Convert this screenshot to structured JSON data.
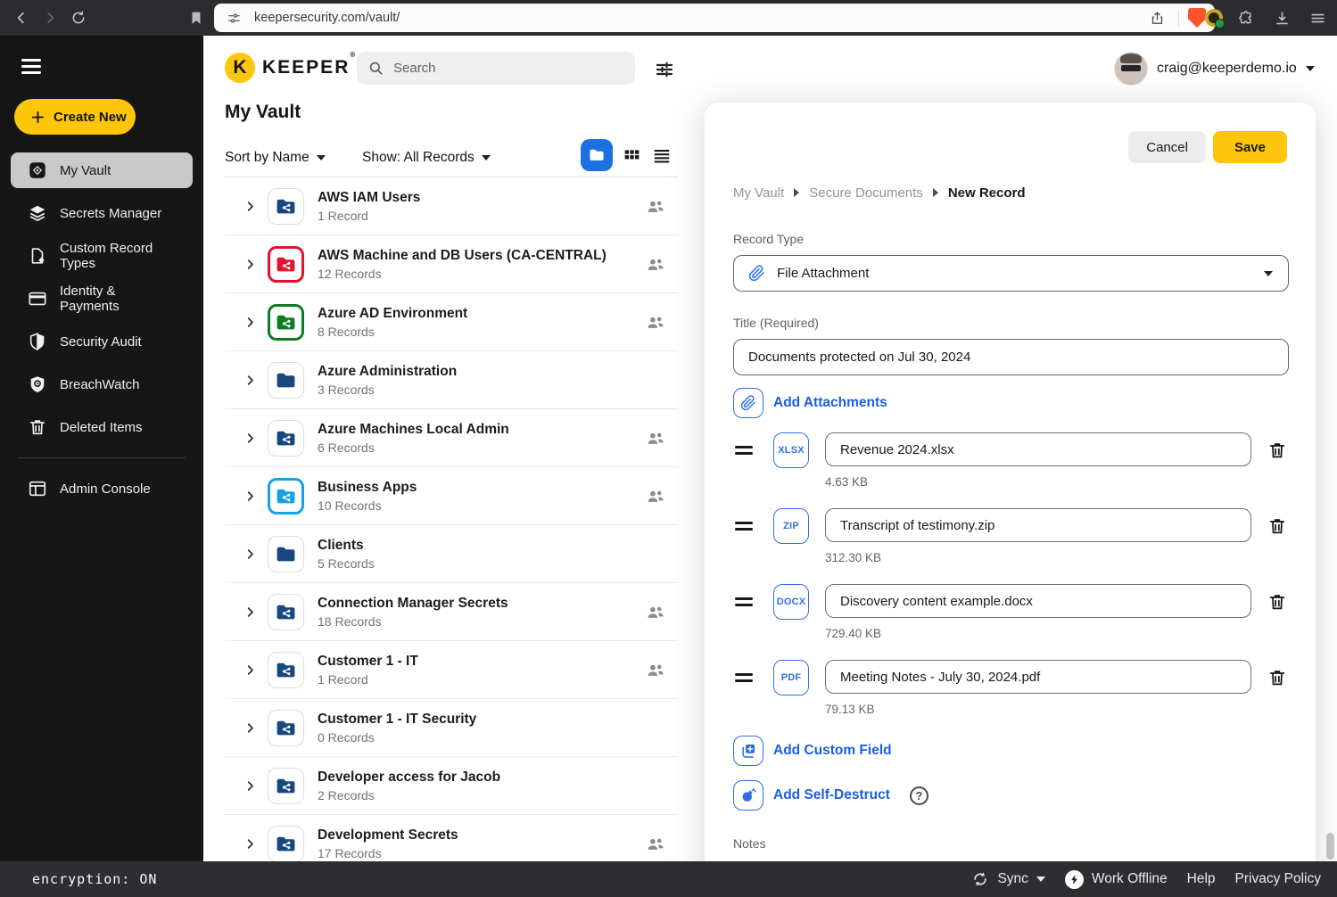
{
  "browser": {
    "url": "keepersecurity.com/vault/"
  },
  "header": {
    "brand": "KEEPER",
    "brand_reg": "®",
    "brand_initial": "K",
    "search_placeholder": "Search",
    "account_email": "craig@keeperdemo.io"
  },
  "sidebar": {
    "create_new": "Create New",
    "items": [
      {
        "label": "My Vault",
        "active": true
      },
      {
        "label": "Secrets Manager"
      },
      {
        "label": "Custom Record Types"
      },
      {
        "label": "Identity & Payments"
      },
      {
        "label": "Security Audit"
      },
      {
        "label": "BreachWatch"
      },
      {
        "label": "Deleted Items"
      },
      {
        "label": "Admin Console"
      }
    ]
  },
  "vault": {
    "title": "My Vault",
    "sort_label": "Sort by Name",
    "show_label": "Show: All Records",
    "folders": [
      {
        "name": "AWS IAM Users",
        "count": "1 Record",
        "style": "default",
        "people": true
      },
      {
        "name": "AWS Machine and DB Users (CA-CENTRAL)",
        "count": "12 Records",
        "style": "red",
        "people": true
      },
      {
        "name": "Azure AD Environment",
        "count": "8 Records",
        "style": "green",
        "people": true
      },
      {
        "name": "Azure Administration",
        "count": "3 Records",
        "style": "plain",
        "people": false
      },
      {
        "name": "Azure Machines Local Admin",
        "count": "6 Records",
        "style": "default",
        "people": true
      },
      {
        "name": "Business Apps",
        "count": "10 Records",
        "style": "cyan",
        "people": true
      },
      {
        "name": "Clients",
        "count": "5 Records",
        "style": "plain",
        "people": false
      },
      {
        "name": "Connection Manager Secrets",
        "count": "18 Records",
        "style": "default",
        "people": true
      },
      {
        "name": "Customer 1 - IT",
        "count": "1 Record",
        "style": "default",
        "people": true
      },
      {
        "name": "Customer 1 - IT Security",
        "count": "0 Records",
        "style": "default",
        "people": false
      },
      {
        "name": "Developer access for Jacob",
        "count": "2 Records",
        "style": "default",
        "people": false
      },
      {
        "name": "Development Secrets",
        "count": "17 Records",
        "style": "default",
        "people": true
      }
    ]
  },
  "modal": {
    "cancel": "Cancel",
    "save": "Save",
    "breadcrumb": [
      "My Vault",
      "Secure Documents",
      "New Record"
    ],
    "record_type_label": "Record Type",
    "record_type_value": "File Attachment",
    "title_label": "Title (Required)",
    "title_value": "Documents protected on Jul 30, 2024",
    "add_attachments": "Add Attachments",
    "attachments": [
      {
        "type": "XLSX",
        "name": "Revenue 2024.xlsx",
        "size": "4.63 KB"
      },
      {
        "type": "ZIP",
        "name": "Transcript of testimony.zip",
        "size": "312.30 KB"
      },
      {
        "type": "DOCX",
        "name": "Discovery content example.docx",
        "size": "729.40 KB"
      },
      {
        "type": "PDF",
        "name": "Meeting Notes - July 30, 2024.pdf",
        "size": "79.13 KB"
      }
    ],
    "add_custom_field": "Add Custom Field",
    "add_self_destruct": "Add Self-Destruct",
    "help_glyph": "?",
    "notes_label": "Notes"
  },
  "statusbar": {
    "encryption": "encryption: ON",
    "sync": "Sync",
    "work_offline": "Work Offline",
    "help": "Help",
    "privacy": "Privacy Policy"
  },
  "colors": {
    "brand_yellow": "#FEC60A",
    "accent_blue": "#1E70E1",
    "link_blue": "#1A5FE0",
    "folder_navy": "#17477E",
    "folder_red": "#E8112D",
    "folder_green": "#0C7D23",
    "folder_cyan": "#18A0E4",
    "sidebar_bg": "#161616",
    "statusbar_bg": "#2E2E32"
  }
}
